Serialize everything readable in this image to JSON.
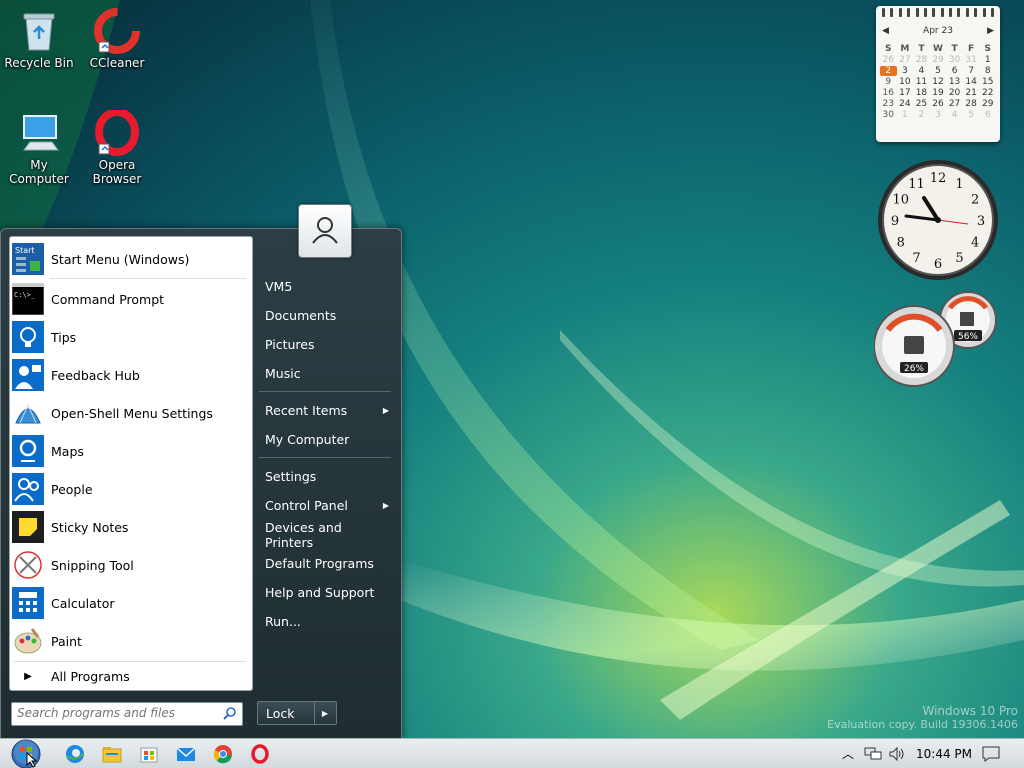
{
  "desktop": {
    "icons": [
      {
        "label": "Recycle Bin"
      },
      {
        "label": "CCleaner"
      },
      {
        "label": "My Computer"
      },
      {
        "label": "Opera Browser"
      }
    ]
  },
  "gadgets": {
    "calendar": {
      "month_label": "Apr 23",
      "days_of_week": [
        "S",
        "M",
        "T",
        "W",
        "T",
        "F",
        "S"
      ],
      "rows": [
        [
          "26",
          "27",
          "28",
          "29",
          "30",
          "31",
          "1"
        ],
        [
          "2",
          "3",
          "4",
          "5",
          "6",
          "7",
          "8"
        ],
        [
          "9",
          "10",
          "11",
          "12",
          "13",
          "14",
          "15"
        ],
        [
          "16",
          "17",
          "18",
          "19",
          "20",
          "21",
          "22"
        ],
        [
          "23",
          "24",
          "25",
          "26",
          "27",
          "28",
          "29"
        ],
        [
          "30",
          "1",
          "2",
          "3",
          "4",
          "5",
          "6"
        ]
      ],
      "today": "2"
    },
    "clock": {
      "numerals": [
        "12",
        "1",
        "2",
        "3",
        "4",
        "5",
        "6",
        "7",
        "8",
        "9",
        "10",
        "11"
      ]
    },
    "cpu_meter": {
      "cpu_value": "26%",
      "ram_value": "56%"
    }
  },
  "start_menu": {
    "pinned": [
      {
        "label": "Start Menu (Windows)",
        "icon": "start-menu-icon"
      },
      {
        "label": "Command Prompt",
        "icon": "command-prompt-icon"
      },
      {
        "label": "Tips",
        "icon": "tips-icon"
      },
      {
        "label": "Feedback Hub",
        "icon": "feedback-hub-icon"
      },
      {
        "label": "Open-Shell Menu Settings",
        "icon": "open-shell-icon"
      },
      {
        "label": "Maps",
        "icon": "maps-icon"
      },
      {
        "label": "People",
        "icon": "people-icon"
      },
      {
        "label": "Sticky Notes",
        "icon": "sticky-notes-icon"
      },
      {
        "label": "Snipping Tool",
        "icon": "snipping-tool-icon"
      },
      {
        "label": "Calculator",
        "icon": "calculator-icon"
      },
      {
        "label": "Paint",
        "icon": "paint-icon"
      }
    ],
    "all_programs": "All Programs",
    "search_placeholder": "Search programs and files",
    "right_items": [
      {
        "label": "VM5"
      },
      {
        "label": "Documents"
      },
      {
        "label": "Pictures"
      },
      {
        "label": "Music"
      },
      {
        "label": "Recent Items",
        "submenu": true
      },
      {
        "label": "My Computer"
      },
      {
        "label": "Settings"
      },
      {
        "label": "Control Panel",
        "submenu": true
      },
      {
        "label": "Devices and Printers"
      },
      {
        "label": "Default Programs"
      },
      {
        "label": "Help and Support"
      },
      {
        "label": "Run..."
      }
    ],
    "lock_label": "Lock"
  },
  "watermark": {
    "line1": "Windows 10 Pro",
    "line2": "Evaluation copy. Build 19306.1406"
  },
  "taskbar": {
    "apps": [
      "edge-icon",
      "file-explorer-icon",
      "store-icon",
      "mail-icon",
      "chrome-icon",
      "opera-icon"
    ],
    "time": "10:44 PM"
  }
}
